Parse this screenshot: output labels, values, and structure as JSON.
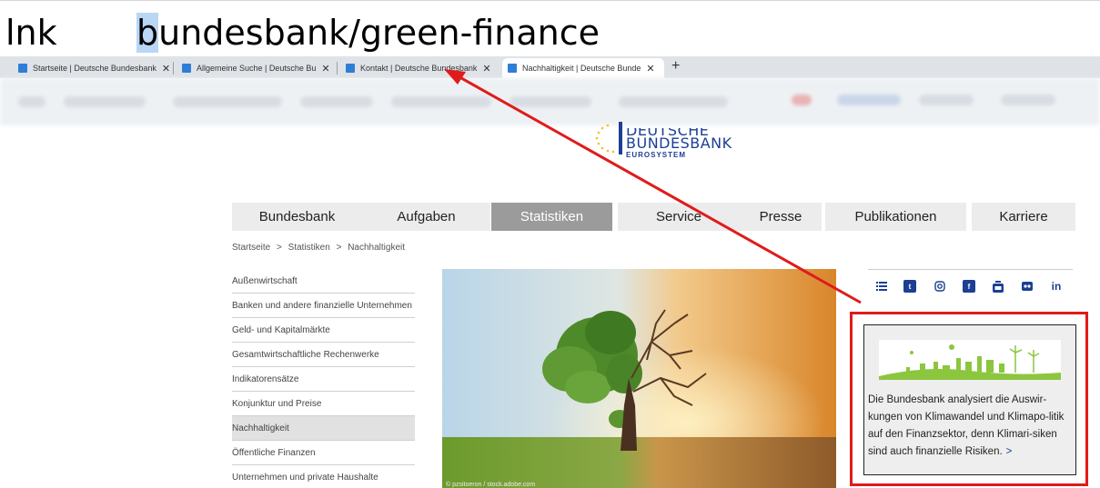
{
  "annotation": {
    "prefix": "lnk",
    "url_highlight": "b",
    "url_rest": "undesbank/green-finance"
  },
  "tabs": [
    {
      "label": "Startseite | Deutsche Bundesbank",
      "close": "✕",
      "active": false
    },
    {
      "label": "Allgemeine Suche | Deutsche Bu",
      "close": "✕",
      "active": false
    },
    {
      "label": "Kontakt | Deutsche Bundesbank",
      "close": "✕",
      "active": false
    },
    {
      "label": "Nachhaltigkeit | Deutsche Bunde",
      "close": "✕",
      "active": true
    }
  ],
  "new_tab": "+",
  "logo": {
    "line1": "DEUTSCHE",
    "line2": "BUNDESBANK",
    "line3": "EUROSYSTEM"
  },
  "nav": [
    {
      "label": "Bundesbank",
      "active": false
    },
    {
      "label": "Aufgaben",
      "active": false
    },
    {
      "label": "Statistiken",
      "active": true
    },
    {
      "label": "Service",
      "active": false
    },
    {
      "label": "Presse",
      "active": false
    },
    {
      "label": "Publikationen",
      "active": false
    },
    {
      "label": "Karriere",
      "active": false
    }
  ],
  "breadcrumb": {
    "items": [
      "Startseite",
      "Statistiken",
      "Nachhaltigkeit"
    ],
    "separator": ">"
  },
  "sidemenu": [
    {
      "label": "Außenwirtschaft",
      "active": false
    },
    {
      "label": "Banken und andere finanzielle Unternehmen",
      "active": false
    },
    {
      "label": "Geld- und Kapitalmärkte",
      "active": false
    },
    {
      "label": "Gesamtwirtschaftliche Rechenwerke",
      "active": false
    },
    {
      "label": "Indikatorensätze",
      "active": false
    },
    {
      "label": "Konjunktur und Preise",
      "active": false
    },
    {
      "label": "Nachhaltigkeit",
      "active": true
    },
    {
      "label": "Öffentliche Finanzen",
      "active": false
    },
    {
      "label": "Unternehmen und private Haushalte",
      "active": false
    }
  ],
  "hero": {
    "credit": "© pzsitoeron / stock.adobe.com"
  },
  "social": {
    "icons": [
      "list-icon",
      "twitter-icon",
      "instagram-icon",
      "facebook-icon",
      "youtube-icon",
      "flickr-icon",
      "linkedin-icon"
    ],
    "linkedin_label": "in"
  },
  "teaser": {
    "text": "Die Bundesbank analysiert die Auswir-kungen von Klimawandel und Klimapo-litik auf den Finanzsektor, denn Klimari-siken sind auch finanzielle Risiken.",
    "arrow": ">"
  },
  "colors": {
    "brand_blue": "#1c3f94",
    "annotation_red": "#e01b1b",
    "nav_active": "#9b9b9b"
  }
}
